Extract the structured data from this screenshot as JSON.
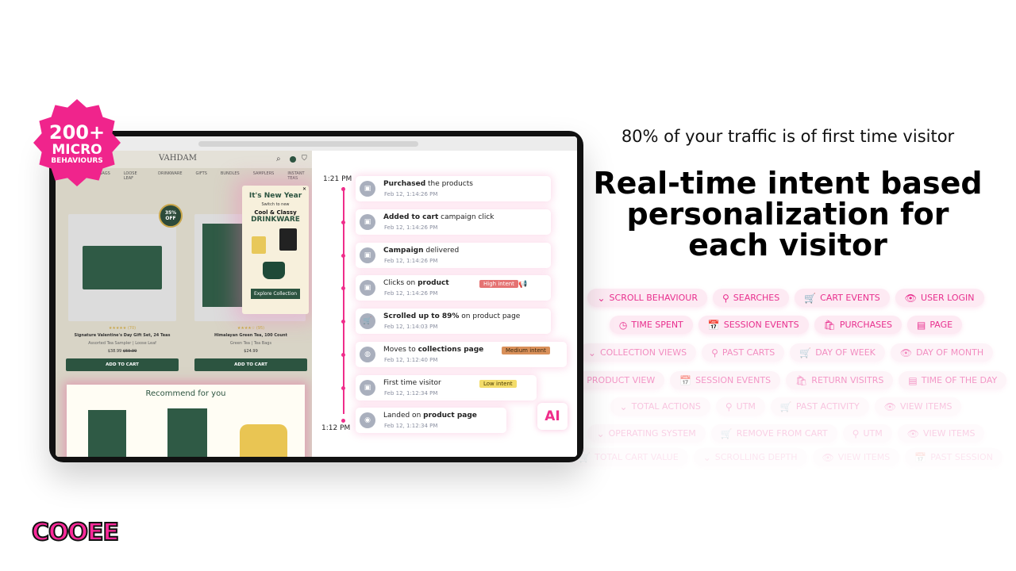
{
  "badge": {
    "line1": "200+",
    "line2": "MICRO",
    "line3": "BEHAVIOURS",
    "color": "#f0248c"
  },
  "site": {
    "logo": "VAHDAM",
    "nav": [
      "BAGS",
      "LOOSE LEAF",
      "DRINKWARE",
      "GIFTS",
      "BUNDLES",
      "SAMPLERS",
      "INSTANT TEAS"
    ],
    "discount": "35% OFF",
    "products": [
      {
        "rating": "★★★★★ (70)",
        "name": "Signature Valentine's Day Gift Set, 24 Teas",
        "sub": "Assorted Tea Sampler | Loose Leaf",
        "price": "$38.99",
        "old_price": "$59.99",
        "button": "ADD TO CART"
      },
      {
        "rating": "★★★★☆ (95)",
        "name": "Himalayan Green Tea, 100 Count",
        "sub": "Green Tea | Tea Bags",
        "price": "$24.99",
        "button": "ADD TO CART"
      }
    ],
    "popup": {
      "title": "It's New Year",
      "sub": "Switch to new",
      "line1": "Cool & Classy",
      "line2": "DRINKWARE",
      "button": "Explore Collection"
    },
    "recommend_title": "Recommend for you"
  },
  "timeline": {
    "start": "1:21 PM",
    "end": "1:12 PM",
    "events": [
      {
        "bold": "Purchased",
        "rest": " the products",
        "date": "Feb 12, 1:14:26 PM",
        "icon": "calendar-icon"
      },
      {
        "bold": "Added to cart",
        "rest": " campaign click",
        "date": "Feb 12, 1:14:26 PM",
        "icon": "calendar-icon"
      },
      {
        "bold": "Campaign",
        "rest": " delivered",
        "date": "Feb 12, 1:14:26 PM",
        "icon": "calendar-icon"
      },
      {
        "bold": "product",
        "pre": "Clicks on ",
        "rest": "",
        "date": "Feb 12, 1:14:26 PM",
        "tag": "High intent",
        "icon": "calendar-icon"
      },
      {
        "bold": "Scrolled up to 89%",
        "rest": " on product page",
        "date": "Feb 12, 1:14:03 PM",
        "icon": "cart-icon"
      },
      {
        "bold": "collections page",
        "pre": "Moves to ",
        "rest": "",
        "date": "Feb 12, 1:12:40 PM",
        "tag": "Medium intent",
        "icon": "mouse-icon"
      },
      {
        "pre": "First time visitor",
        "bold": "",
        "rest": "",
        "date": "Feb 12, 1:12:34 PM",
        "tag": "Low intent",
        "icon": "calendar-icon"
      },
      {
        "pre": "Landed on ",
        "bold": "product page",
        "rest": "",
        "date": "Feb 12, 1:12:34 PM",
        "icon": "eye-icon"
      }
    ],
    "ai_label": "AI",
    "tag_colors": {
      "high": "#e57373",
      "medium": "#d9905a",
      "low": "#f3dc6a"
    }
  },
  "right": {
    "subtitle": "80% of your traffic is of first time visitor",
    "headline": [
      "Real-time intent based",
      "personalization for",
      "each visitor"
    ],
    "chip_rows": [
      [
        [
          "chevrons-icon",
          "SCROLL BEHAVIOUR"
        ],
        [
          "search-icon",
          "SEARCHES"
        ],
        [
          "cart-icon",
          "CART EVENTS"
        ],
        [
          "eye-icon",
          "USER LOGIN"
        ]
      ],
      [
        [
          "clock-icon",
          "TIME SPENT"
        ],
        [
          "calendar-clock-icon",
          "SESSION EVENTS"
        ],
        [
          "bag-icon",
          "PURCHASES"
        ],
        [
          "page-icon",
          "PAGE"
        ]
      ],
      [
        [
          "chevrons-icon",
          "COLLECTION VIEWS"
        ],
        [
          "search-icon",
          "PAST CARTS"
        ],
        [
          "cart-icon",
          "DAY OF WEEK"
        ],
        [
          "eye-icon",
          "DAY OF MONTH"
        ]
      ],
      [
        [
          "clock-icon",
          "PRODUCT VIEW"
        ],
        [
          "calendar-clock-icon",
          "SESSION EVENTS"
        ],
        [
          "bag-icon",
          "RETURN VISITRS"
        ],
        [
          "page-icon",
          "TIME OF THE DAY"
        ]
      ],
      [
        [
          "chevrons-icon",
          "TOTAL ACTIONS"
        ],
        [
          "search-icon",
          "UTM"
        ],
        [
          "cart-icon",
          "PAST ACTIVITY"
        ],
        [
          "eye-icon",
          "VIEW ITEMS"
        ]
      ],
      [
        [
          "chevrons-icon",
          "OPERATING SYSTEM"
        ],
        [
          "cart-icon",
          "REMOVE FROM CART"
        ],
        [
          "search-icon",
          "UTM"
        ],
        [
          "eye-icon",
          "VIEW ITEMS"
        ]
      ],
      [
        [
          "cart-icon",
          "TOTAL CART VALUE"
        ],
        [
          "chevrons-icon",
          "SCROLLING DEPTH"
        ],
        [
          "eye-icon",
          "VIEW ITEMS"
        ],
        [
          "calendar-clock-icon",
          "PAST SESSION"
        ]
      ]
    ]
  },
  "brand": {
    "logo": "COOEE",
    "accent": "#ff2a9b"
  }
}
